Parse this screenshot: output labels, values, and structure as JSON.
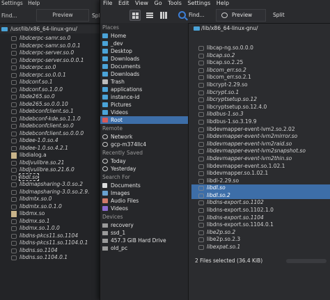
{
  "back": {
    "menu": [
      "Settings",
      "Help"
    ],
    "find_label": "Find...",
    "preview_label": "Preview",
    "split_label": "Split",
    "path": "/usr/lib/x86_64-linux-gnu/",
    "files": [
      {
        "name": "libdcerpc-samr.so.0",
        "style": "link"
      },
      {
        "name": "libdcerpc-samr.so.0.0.1",
        "style": "link"
      },
      {
        "name": "libdcerpc-server.so.0",
        "style": "link"
      },
      {
        "name": "libdcerpc-server.so.0.0.1",
        "style": "link"
      },
      {
        "name": "libdcerpc.so.0",
        "style": "link"
      },
      {
        "name": "libdcerpc.so.0.0.1",
        "style": "link"
      },
      {
        "name": "libdconf.so.1",
        "style": "link"
      },
      {
        "name": "libdconf.so.1.0.0",
        "style": "link"
      },
      {
        "name": "libde265.so.0",
        "style": "link"
      },
      {
        "name": "libde265.so.0.0.10",
        "style": "link"
      },
      {
        "name": "libdebconfclient.so.1",
        "style": "link"
      },
      {
        "name": "libdebconf-kde.so.1.1.0",
        "style": "link"
      },
      {
        "name": "libdebconfclient.so.0",
        "style": "link"
      },
      {
        "name": "libdebconfclient.so.0.0.0",
        "style": "link"
      },
      {
        "name": "libdee-1.0.so.4",
        "style": "link"
      },
      {
        "name": "libdee-1.0.so.4.2.1",
        "style": "link"
      },
      {
        "name": "libdialog.a",
        "style": "doc"
      },
      {
        "name": "libdjvulibre.so.21",
        "style": "link"
      },
      {
        "name": "libdjvulibre.so.21.6.0",
        "style": "link"
      },
      {
        "name": "libdl.so",
        "style": "selected"
      },
      {
        "name": "libdmapsharing-3.0.so.2",
        "style": "link"
      },
      {
        "name": "libdmapsharing-3.0.so.2.9.",
        "style": "link"
      },
      {
        "name": "libdmtx.so.0",
        "style": "link"
      },
      {
        "name": "libdmtx.so.0.1.0",
        "style": "link"
      },
      {
        "name": "libdmx.so",
        "style": "doc"
      },
      {
        "name": "libdmx.so.1",
        "style": "link"
      },
      {
        "name": "libdmx.so.1.0.0",
        "style": "link"
      },
      {
        "name": "libdns-pkcs11.so.1104",
        "style": "link"
      },
      {
        "name": "libdns-pkcs11.so.1104.0.1",
        "style": "link"
      },
      {
        "name": "libdns.so.1104",
        "style": "link"
      },
      {
        "name": "libdns.so.1104.0.1",
        "style": "link"
      }
    ]
  },
  "dialog": {
    "menu": [
      "File",
      "Edit",
      "View",
      "Go",
      "Tools",
      "Settings",
      "Help"
    ],
    "find_label": "Find...",
    "preview_label": "Preview",
    "split_label": "Split",
    "path": "/lib/x86_64-linux-gnu/",
    "sidebar": [
      {
        "section": "Places",
        "items": [
          {
            "label": "Home",
            "icon": "home-icon"
          },
          {
            "label": "_dev",
            "icon": "folder-icon"
          },
          {
            "label": "Desktop",
            "icon": "folder-icon"
          },
          {
            "label": "Downloads",
            "icon": "folder-icon"
          },
          {
            "label": "Documents",
            "icon": "folder-icon"
          },
          {
            "label": "Downloads",
            "icon": "folder-icon"
          },
          {
            "label": "Trash",
            "icon": "trash-icon"
          },
          {
            "label": "applications",
            "icon": "folder-icon"
          },
          {
            "label": "instance-id",
            "icon": "folder-icon"
          },
          {
            "label": "Pictures",
            "icon": "folder-icon"
          },
          {
            "label": "Videos",
            "icon": "folder-icon"
          },
          {
            "label": "Root",
            "icon": "root-icon",
            "active": true
          }
        ]
      },
      {
        "section": "Remote",
        "items": [
          {
            "label": "Network",
            "icon": "network-icon"
          },
          {
            "label": "gcp-m374llc4",
            "icon": "network-icon"
          }
        ]
      },
      {
        "section": "Recently Saved",
        "items": [
          {
            "label": "Today",
            "icon": "clock-icon"
          },
          {
            "label": "Yesterday",
            "icon": "clock-icon"
          }
        ]
      },
      {
        "section": "Search For",
        "items": [
          {
            "label": "Documents",
            "icon": "document-icon"
          },
          {
            "label": "Images",
            "icon": "image-icon"
          },
          {
            "label": "Audio Files",
            "icon": "audio-icon"
          },
          {
            "label": "Videos",
            "icon": "video-icon"
          }
        ]
      },
      {
        "section": "Devices",
        "items": [
          {
            "label": "recovery",
            "icon": "drive-icon"
          },
          {
            "label": "ssd_1",
            "icon": "drive-icon"
          },
          {
            "label": "457.3 GiB Hard Drive",
            "icon": "drive-icon"
          },
          {
            "label": "old_pc",
            "icon": "drive-icon"
          }
        ]
      }
    ],
    "files": [
      {
        "name": "libcap-ng.so.0.0.0",
        "style": "normal"
      },
      {
        "name": "libcap.so.2",
        "style": "italic"
      },
      {
        "name": "libcap.so.2.25",
        "style": "normal"
      },
      {
        "name": "libcom_err.so.2",
        "style": "italic"
      },
      {
        "name": "libcom_err.so.2.1",
        "style": "normal"
      },
      {
        "name": "libcrypt-2.29.so",
        "style": "normal"
      },
      {
        "name": "libcrypt.so.1",
        "style": "italic"
      },
      {
        "name": "libcryptsetup.so.12",
        "style": "italic"
      },
      {
        "name": "libcryptsetup.so.12.4.0",
        "style": "normal"
      },
      {
        "name": "libdbus-1.so.3",
        "style": "italic"
      },
      {
        "name": "libdbus-1.so.3.19.9",
        "style": "normal"
      },
      {
        "name": "libdevmapper-event-lvm2.so.2.02",
        "style": "normal"
      },
      {
        "name": "libdevmapper-event-lvm2mirror.so",
        "style": "italic"
      },
      {
        "name": "libdevmapper-event-lvm2raid.so",
        "style": "italic"
      },
      {
        "name": "libdevmapper-event-lvm2snapshot.so",
        "style": "italic"
      },
      {
        "name": "libdevmapper-event-lvm2thin.so",
        "style": "italic"
      },
      {
        "name": "libdevmapper-event.so.1.02.1",
        "style": "normal"
      },
      {
        "name": "libdevmapper.so.1.02.1",
        "style": "normal"
      },
      {
        "name": "libdl-2.29.so",
        "style": "normal"
      },
      {
        "name": "libdl.so",
        "style": "selected"
      },
      {
        "name": "libdl.so.2",
        "style": "selected"
      },
      {
        "name": "libdns-export.so.1102",
        "style": "italic"
      },
      {
        "name": "libdns-export.so.1102.1.0",
        "style": "normal"
      },
      {
        "name": "libdns-export.so.1104",
        "style": "italic"
      },
      {
        "name": "libdns-export.so.1104.0.1",
        "style": "normal"
      },
      {
        "name": "libe2p.so.2",
        "style": "italic"
      },
      {
        "name": "libe2p.so.2.3",
        "style": "normal"
      },
      {
        "name": "libexpat.so.1",
        "style": "italic"
      }
    ],
    "status": "2 Files selected (36.4 KiB)"
  },
  "colors": {
    "selection": "#3d6ea8",
    "folder": "#4aa3d8",
    "search_accent": "#3d7fd6"
  }
}
